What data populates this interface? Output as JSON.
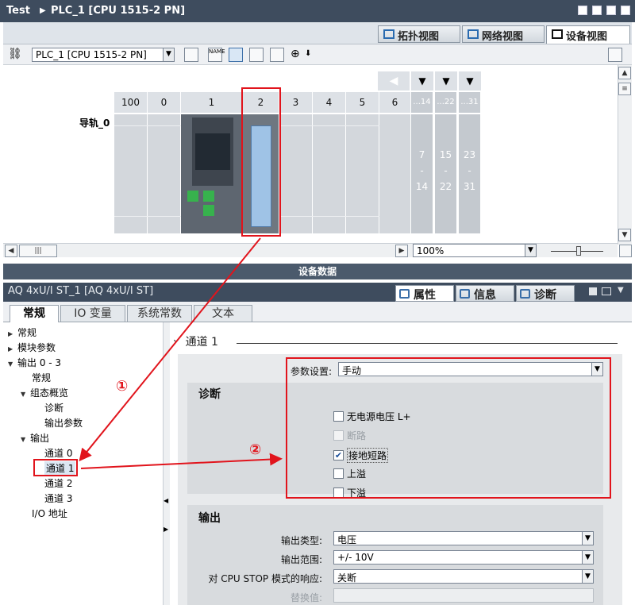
{
  "window": {
    "project": "Test",
    "device": "PLC_1 [CPU 1515-2 PN]"
  },
  "view_tabs": [
    {
      "label": "拓扑视图",
      "icon": "topology-icon"
    },
    {
      "label": "网络视图",
      "icon": "network-icon"
    },
    {
      "label": "设备视图",
      "icon": "device-icon",
      "active": true
    }
  ],
  "toolbar": {
    "device_select": "PLC_1 [CPU 1515-2 PN]"
  },
  "rack": {
    "rail_label": "导轨_0",
    "slots": [
      "100",
      "0",
      "1",
      "2",
      "3",
      "4",
      "5",
      "6"
    ],
    "grouped_headers": [
      "...14",
      "...22",
      "...31"
    ],
    "grouped_ranges": [
      {
        "start": "7",
        "dash": "-",
        "end": "14"
      },
      {
        "start": "15",
        "dash": "-",
        "end": "22"
      },
      {
        "start": "23",
        "dash": "-",
        "end": "31"
      }
    ],
    "highlighted_slot": "2"
  },
  "zoom": {
    "value": "100%"
  },
  "device_data_label": "设备数据",
  "inspector": {
    "module_title": "AQ 4xU/I ST_1 [AQ 4xU/I ST]",
    "tabs": [
      "属性",
      "信息",
      "诊断"
    ],
    "active_tab": "属性",
    "subtabs": [
      "常规",
      "IO 变量",
      "系统常数",
      "文本"
    ],
    "active_subtab": "常规"
  },
  "nav": [
    {
      "label": "常规",
      "level": 0,
      "arrow": "right"
    },
    {
      "label": "模块参数",
      "level": 0,
      "arrow": "right"
    },
    {
      "label": "输出 0 - 3",
      "level": 0,
      "arrow": "down"
    },
    {
      "label": "常规",
      "level": 1,
      "arrow": ""
    },
    {
      "label": "组态概览",
      "level": 1,
      "arrow": "down"
    },
    {
      "label": "诊断",
      "level": 2,
      "arrow": ""
    },
    {
      "label": "输出参数",
      "level": 2,
      "arrow": ""
    },
    {
      "label": "输出",
      "level": 1,
      "arrow": "down"
    },
    {
      "label": "通道 0",
      "level": 2,
      "arrow": ""
    },
    {
      "label": "通道 1",
      "level": 2,
      "arrow": "",
      "selected": true
    },
    {
      "label": "通道 2",
      "level": 2,
      "arrow": ""
    },
    {
      "label": "通道 3",
      "level": 2,
      "arrow": ""
    },
    {
      "label": "I/O 地址",
      "level": 0,
      "arrow": ""
    }
  ],
  "channel": {
    "section_title": "通道 1",
    "param_setting_label": "参数设置:",
    "param_setting_value": "手动",
    "diag_group_title": "诊断",
    "diag_options": [
      {
        "label": "无电源电压 L+",
        "checked": false,
        "disabled": false
      },
      {
        "label": "断路",
        "checked": false,
        "disabled": true
      },
      {
        "label": "接地短路",
        "checked": true,
        "disabled": false
      },
      {
        "label": "上溢",
        "checked": false,
        "disabled": false
      },
      {
        "label": "下溢",
        "checked": false,
        "disabled": false
      }
    ],
    "output_group_title": "输出",
    "output_type_label": "输出类型:",
    "output_type_value": "电压",
    "output_range_label": "输出范围:",
    "output_range_value": "+/- 10V",
    "cpu_stop_label": "对 CPU STOP 模式的响应:",
    "cpu_stop_value": "关断",
    "substitute_label": "替换值:",
    "substitute_value": ""
  },
  "annotations": {
    "marker1": "①",
    "marker2": "②",
    "color": "#e1141c"
  }
}
